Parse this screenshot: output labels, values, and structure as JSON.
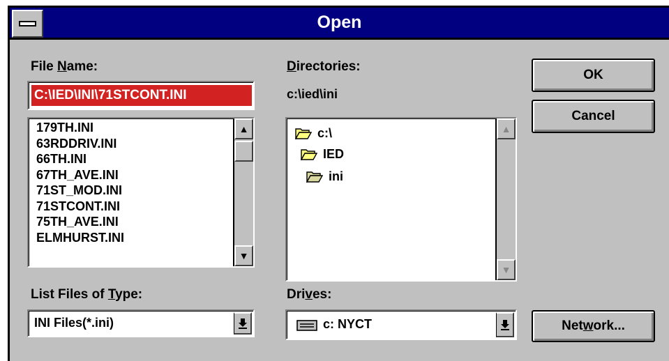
{
  "window": {
    "title": "Open"
  },
  "file_name": {
    "label_pre": "File ",
    "label_ul": "N",
    "label_post": "ame:",
    "value": "C:\\IED\\INI\\71STCONT.INI",
    "files": [
      "179TH.INI",
      "63RDDRIV.INI",
      "66TH.INI",
      "67TH_AVE.INI",
      "71ST_MOD.INI",
      "71STCONT.INI",
      "75TH_AVE.INI",
      "ELMHURST.INI"
    ]
  },
  "directories": {
    "label_ul": "D",
    "label_post": "irectories:",
    "current": "c:\\ied\\ini",
    "tree": [
      "c:\\",
      "IED",
      "ini"
    ]
  },
  "file_type": {
    "label_pre": "List Files of ",
    "label_ul": "T",
    "label_post": "ype:",
    "value": "INI Files(*.ini)"
  },
  "drives": {
    "label_pre": "Dri",
    "label_ul": "v",
    "label_post": "es:",
    "value": "c: NYCT"
  },
  "buttons": {
    "ok": "OK",
    "cancel": "Cancel",
    "network_pre": "Net",
    "network_ul": "w",
    "network_post": "ork..."
  },
  "icons": {
    "system_menu": "system-menu-icon",
    "scroll_up": "arrow-up-icon",
    "scroll_down": "arrow-down-icon",
    "dropdown": "dropdown-arrow-icon",
    "folder_open": "folder-open-icon",
    "drive": "drive-icon"
  }
}
